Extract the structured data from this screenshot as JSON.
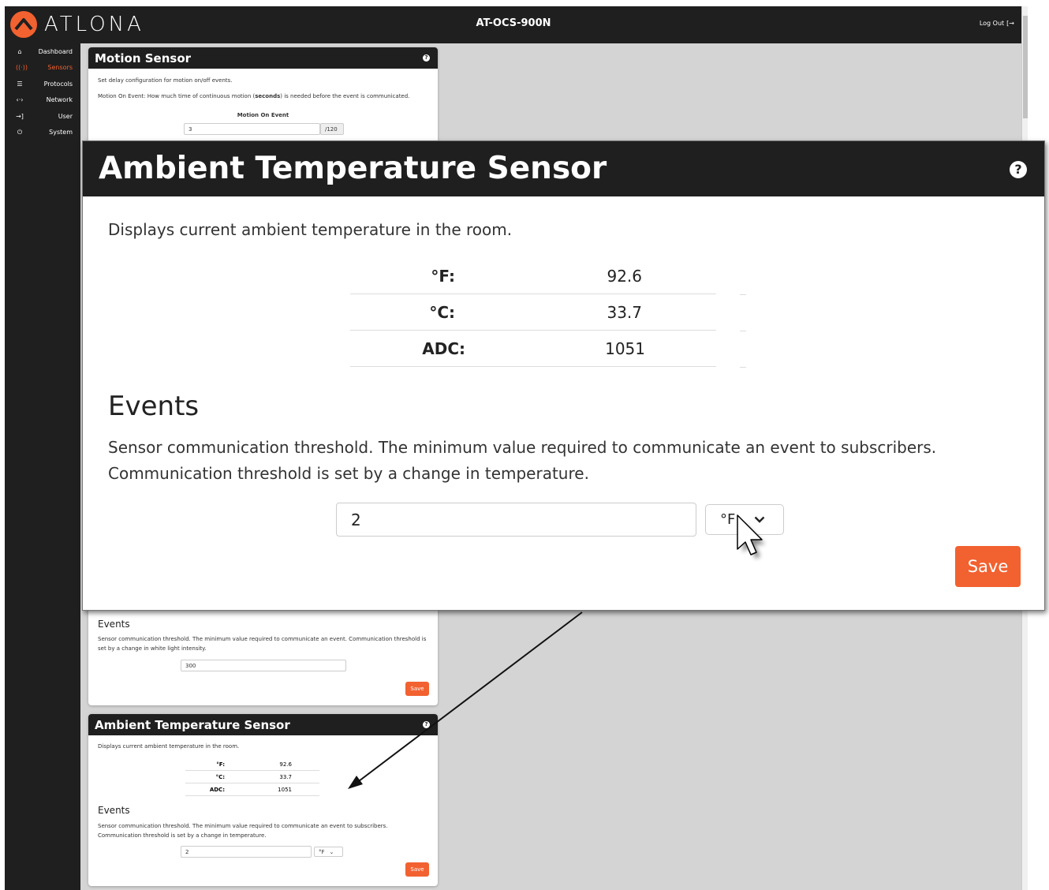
{
  "header": {
    "logo_text": "ATLONA",
    "device_name": "AT-OCS-900N",
    "logout_label": "Log Out"
  },
  "sidebar": {
    "items": [
      {
        "label": "Dashboard",
        "icon": "home-icon",
        "active": false
      },
      {
        "label": "Sensors",
        "icon": "sensor-icon",
        "active": true
      },
      {
        "label": "Protocols",
        "icon": "protocols-icon",
        "active": false
      },
      {
        "label": "Network",
        "icon": "network-icon",
        "active": false
      },
      {
        "label": "User",
        "icon": "login-icon",
        "active": false
      },
      {
        "label": "System",
        "icon": "plug-icon",
        "active": false
      }
    ]
  },
  "motion_card": {
    "title": "Motion Sensor",
    "desc": "Set delay configuration for motion on/off events.",
    "event_desc_pre": "Motion On Event: How much time of continuous motion (",
    "event_desc_bold": "seconds",
    "event_desc_post": ") is needed before the event is communicated.",
    "field_label": "Motion On Event",
    "field_value": "3",
    "field_suffix": "/120"
  },
  "light_card": {
    "events_heading": "Events",
    "events_desc": "Sensor communication threshold. The minimum value required to communicate an event. Communication threshold is set by a change in white light intensity.",
    "threshold_value": "300",
    "save_label": "Save"
  },
  "temp_card": {
    "title": "Ambient Temperature Sensor",
    "desc": "Displays current ambient temperature in the room.",
    "readings": [
      {
        "label": "°F:",
        "value": "92.6"
      },
      {
        "label": "°C:",
        "value": "33.7"
      },
      {
        "label": "ADC:",
        "value": "1051"
      }
    ],
    "events_heading": "Events",
    "events_desc": "Sensor communication threshold. The minimum value required to communicate an event to subscribers. Communication threshold is set by a change in temperature.",
    "threshold_value": "2",
    "unit_selected": "°F",
    "save_label": "Save"
  },
  "zoom_callout": {
    "title": "Ambient Temperature Sensor",
    "desc": "Displays current ambient temperature in the room.",
    "readings": [
      {
        "label": "°F:",
        "value": "92.6"
      },
      {
        "label": "°C:",
        "value": "33.7"
      },
      {
        "label": "ADC:",
        "value": "1051"
      }
    ],
    "events_heading": "Events",
    "events_line1": "Sensor communication threshold. The minimum value required to communicate an event to subscribers.",
    "events_line2": "Communication threshold is set by a change in temperature.",
    "threshold_value": "2",
    "unit_selected": "°F",
    "save_label": "Save"
  },
  "colors": {
    "accent": "#f26130",
    "dark": "#1f1f1f",
    "background": "#d4d4d4"
  }
}
